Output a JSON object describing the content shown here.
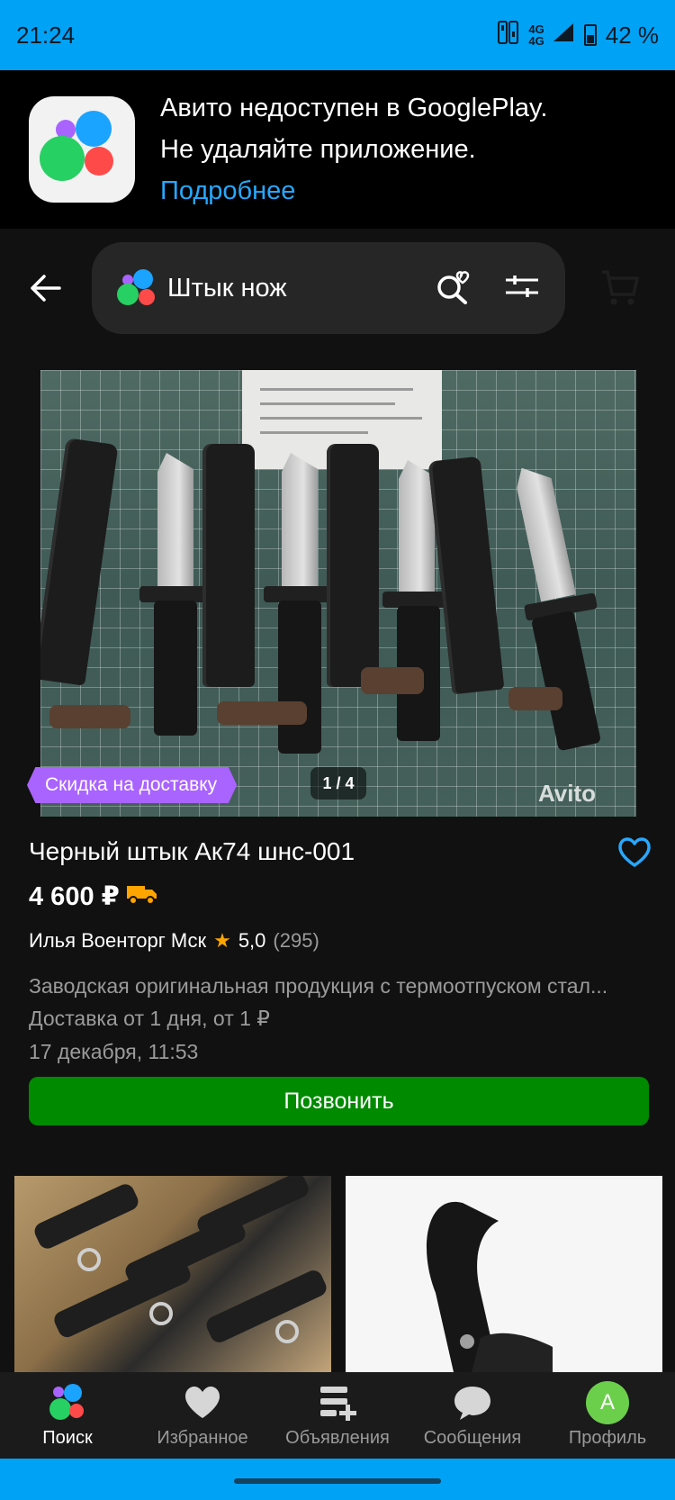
{
  "status_bar": {
    "time": "21:24",
    "network_top": "4G",
    "network_bottom": "4G",
    "battery": "42 %"
  },
  "banner": {
    "line1": "Авито недоступен в GooglePlay.",
    "line2": "Не удаляйте приложение.",
    "link": "Подробнее"
  },
  "search": {
    "query": "Штык нож"
  },
  "listing": {
    "badge": "Скидка на доставку",
    "image_counter": "1 / 4",
    "watermark": "Avito",
    "title": "Черный штык Ак74 шнс-001",
    "price": "4 600 ₽",
    "seller": "Илья Военторг Мск",
    "rating": "5,0",
    "reviews": "(295)",
    "description": "Заводская оригинальная продукция с термоотпуском стал...",
    "delivery": "Доставка от 1 дня, от 1 ₽",
    "date": "17 декабря, 11:53",
    "call_label": "Позвонить"
  },
  "nav": {
    "items": [
      {
        "label": "Поиск",
        "icon": "search-logo-icon",
        "active": true
      },
      {
        "label": "Избранное",
        "icon": "heart-icon"
      },
      {
        "label": "Объявления",
        "icon": "add-listing-icon"
      },
      {
        "label": "Сообщения",
        "icon": "chat-icon"
      },
      {
        "label": "Профиль",
        "icon": "avatar",
        "avatar_letter": "A"
      }
    ]
  },
  "colors": {
    "status_bar": "#00a2f5",
    "link": "#26a8ff",
    "call_button": "#008a00",
    "badge": "#a963ff",
    "rating_star": "#ffa500",
    "avatar": "#6ccf4c"
  }
}
